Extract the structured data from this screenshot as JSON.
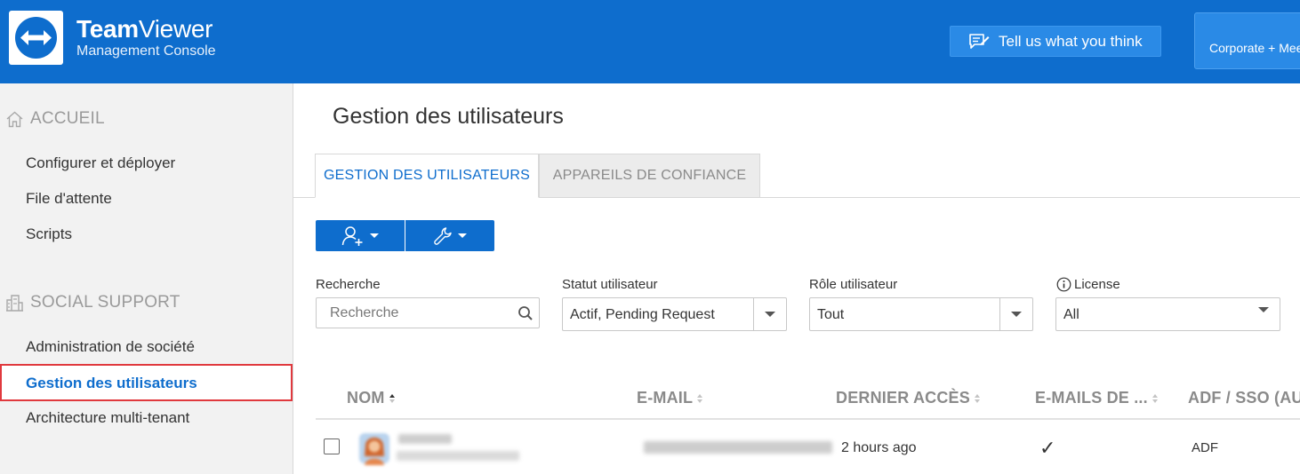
{
  "header": {
    "brand_bold": "Team",
    "brand_thin": "Viewer",
    "subtitle": "Management Console",
    "feedback_label": "Tell us what you think",
    "corporate_label": "Corporate + Mee",
    "brand_color": "#0e6dcd"
  },
  "sidebar": {
    "sections": [
      {
        "title": "ACCUEIL",
        "icon": "home-icon",
        "items": [
          {
            "label": "Configurer et déployer"
          },
          {
            "label": "File d'attente"
          },
          {
            "label": "Scripts"
          }
        ]
      },
      {
        "title": "SOCIAL SUPPORT",
        "icon": "building-icon",
        "items": [
          {
            "label": "Administration de société"
          },
          {
            "label": "Gestion des utilisateurs",
            "active": true
          },
          {
            "label": "Architecture multi-tenant"
          }
        ]
      }
    ]
  },
  "main": {
    "title": "Gestion des utilisateurs",
    "tabs": [
      {
        "label": "GESTION DES UTILISATEURS",
        "active": true
      },
      {
        "label": "APPAREILS DE CONFIANCE",
        "active": false
      }
    ],
    "toolbar": {
      "buttons": [
        {
          "icon": "add-user-icon"
        },
        {
          "icon": "wrench-icon"
        }
      ]
    },
    "filters": {
      "search": {
        "label": "Recherche",
        "placeholder": "Recherche",
        "value": ""
      },
      "status": {
        "label": "Statut utilisateur",
        "value": "Actif, Pending Request"
      },
      "role": {
        "label": "Rôle utilisateur",
        "value": "Tout"
      },
      "license": {
        "label": "License",
        "value": "All",
        "icon": "info-icon"
      }
    },
    "table": {
      "columns": [
        {
          "label": "NOM"
        },
        {
          "label": "E-MAIL"
        },
        {
          "label": "DERNIER ACCÈS"
        },
        {
          "label": "E-MAILS DE ..."
        },
        {
          "label": "ADF / SSO (AU"
        }
      ],
      "rows": [
        {
          "last_access": "2 hours ago",
          "emails": "✓",
          "adf": "ADF"
        }
      ]
    }
  }
}
